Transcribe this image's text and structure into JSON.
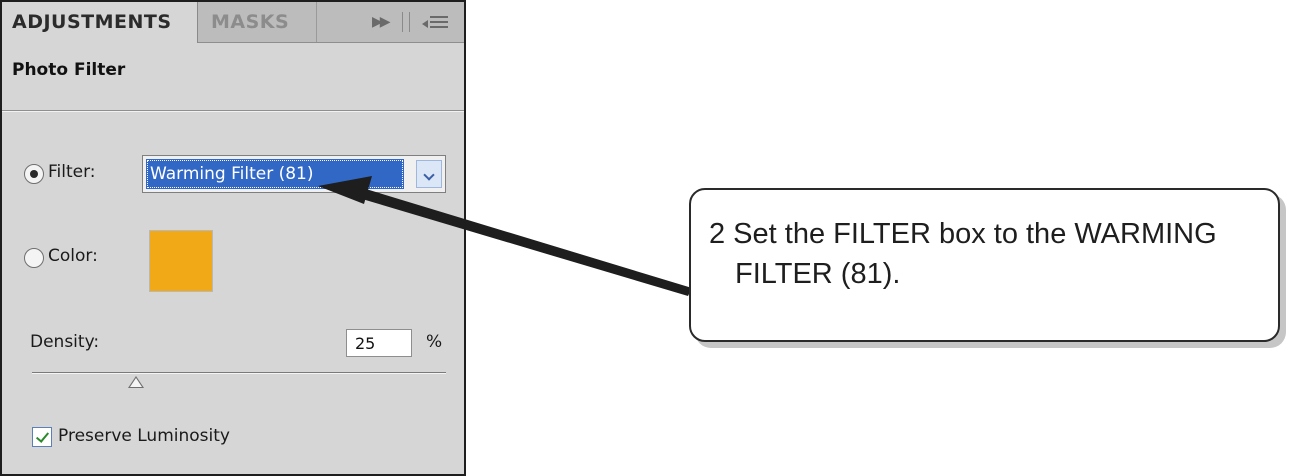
{
  "panel": {
    "tabs": [
      {
        "label": "ADJUSTMENTS",
        "active": true
      },
      {
        "label": "MASKS",
        "active": false
      }
    ],
    "section_title": "Photo Filter",
    "filter_option": {
      "label": "Filter:",
      "selected": true
    },
    "filter_select": {
      "value": "Warming Filter (81)"
    },
    "color_option": {
      "label": "Color:",
      "selected": false,
      "swatch": "#f2a918"
    },
    "density": {
      "label": "Density:",
      "value": "25",
      "unit": "%",
      "slider_fraction": 0.25
    },
    "preserve_luminosity": {
      "label": "Preserve Luminosity",
      "checked": true
    }
  },
  "callout": {
    "text": "2 Set the FILTER box to the WARMING FILTER (81)."
  },
  "colors": {
    "panel_bg": "#d6d6d6",
    "selection": "#3168c6",
    "swatch": "#f2a918"
  }
}
